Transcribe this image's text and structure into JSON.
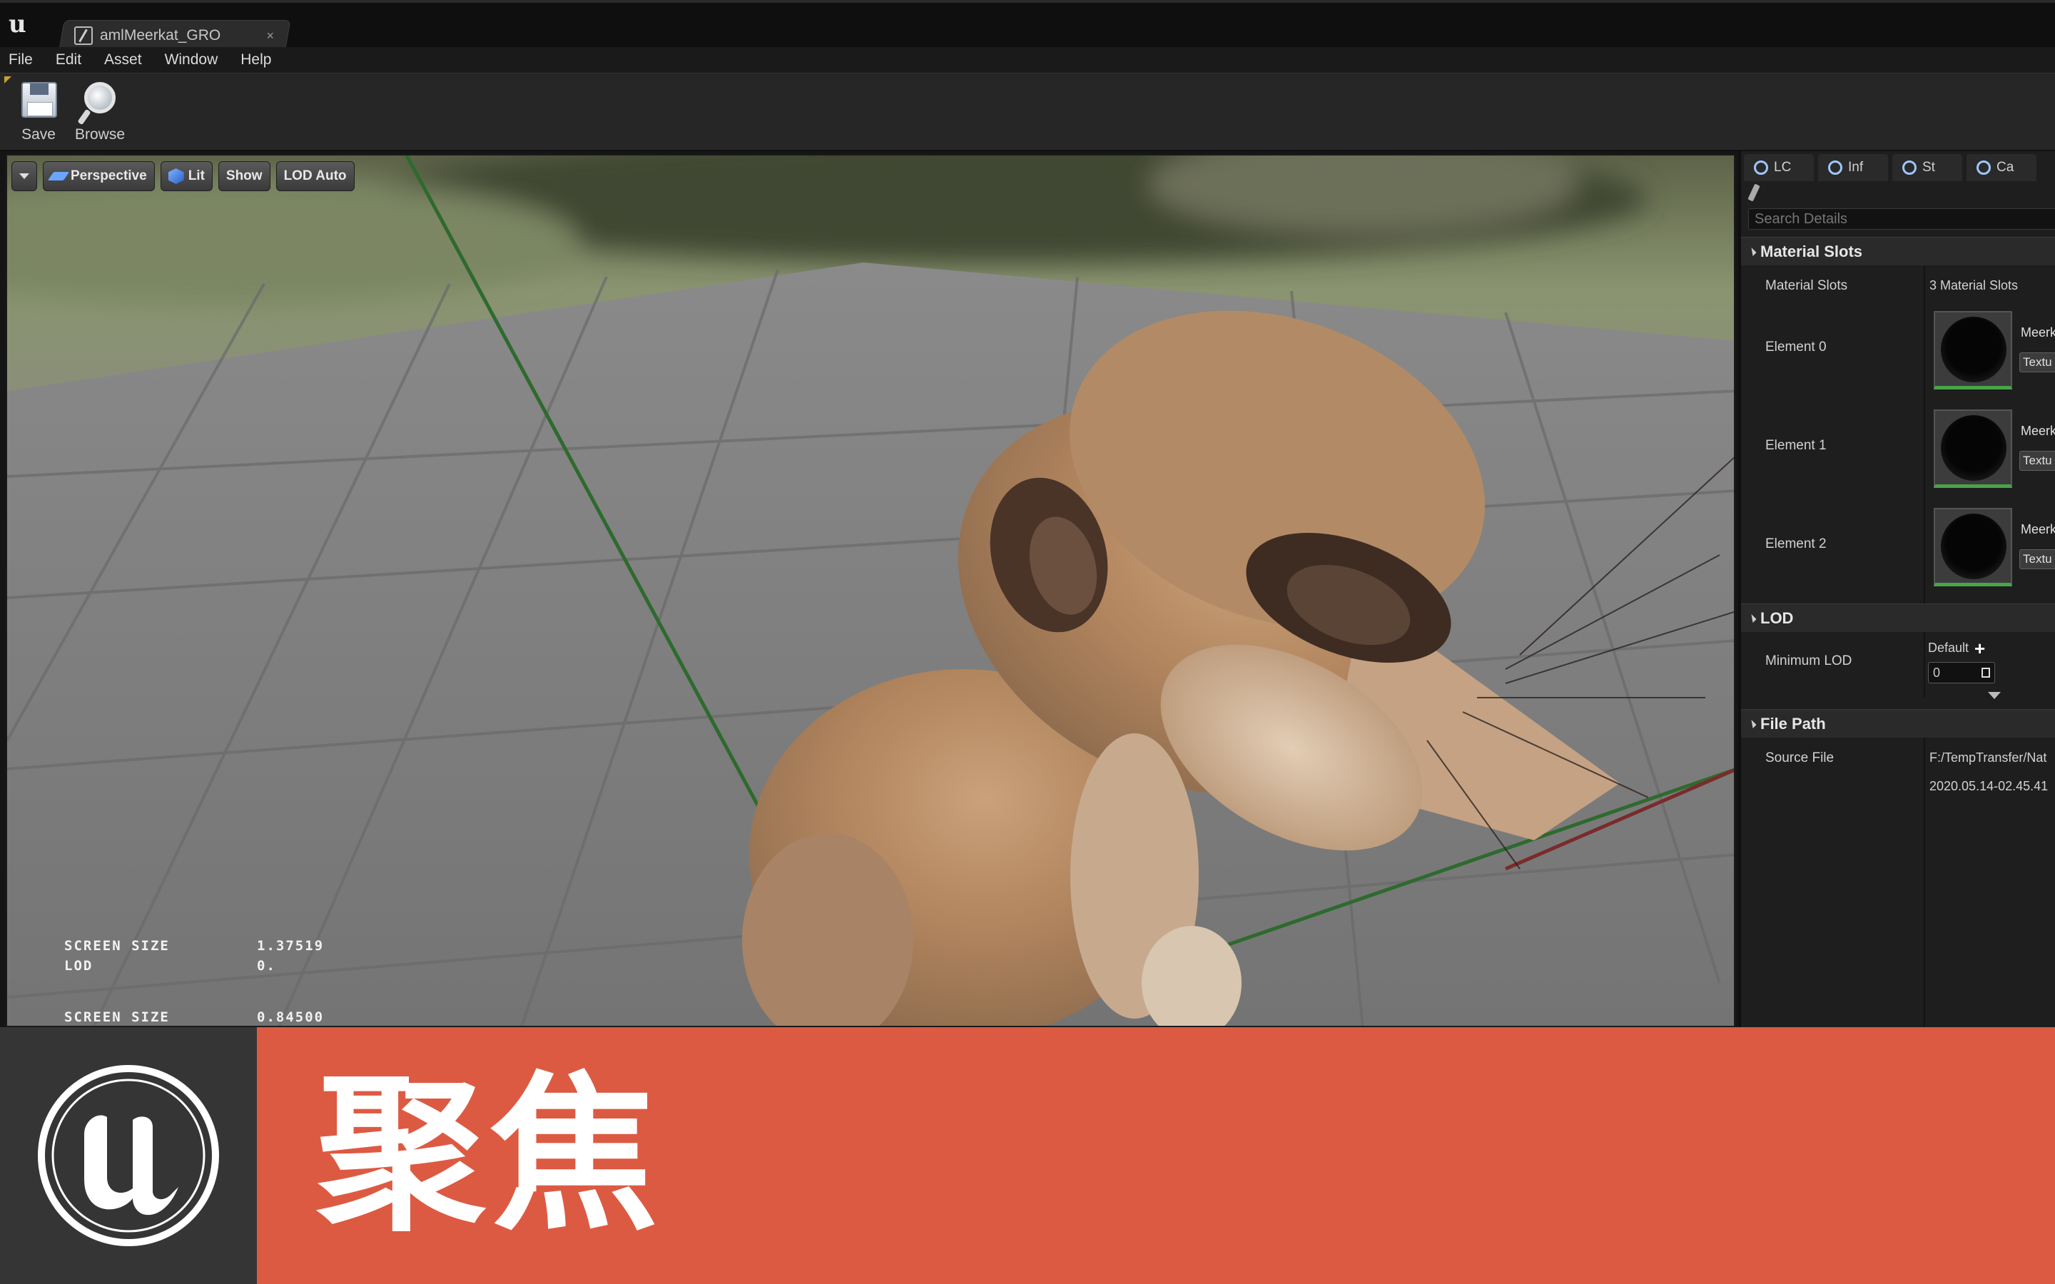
{
  "titlebar": {
    "tab_label": "amlMeerkat_GRO",
    "close_glyph": "×"
  },
  "menu": [
    "File",
    "Edit",
    "Asset",
    "Window",
    "Help"
  ],
  "toolbar": {
    "save_label": "Save",
    "browse_label": "Browse"
  },
  "viewport": {
    "buttons": {
      "perspective": "Perspective",
      "lit": "Lit",
      "show": "Show",
      "lod": "LOD Auto"
    },
    "stats": [
      {
        "key": "SCREEN SIZE",
        "value": "1.37519"
      },
      {
        "key": "LOD",
        "value": "0."
      },
      {
        "key": "SCREEN SIZE",
        "value": "0.84500"
      }
    ]
  },
  "details": {
    "tabs": [
      "LC",
      "Inf",
      "St",
      "Ca"
    ],
    "search_placeholder": "Search Details",
    "material_slots": {
      "heading": "Material Slots",
      "label": "Material Slots",
      "count": "3 Material Slots",
      "elements": [
        {
          "label": "Element 0",
          "name": "Meerk",
          "combo": "Textu"
        },
        {
          "label": "Element 1",
          "name": "Meerk",
          "combo": "Textu"
        },
        {
          "label": "Element 2",
          "name": "Meerk",
          "combo": "Textu"
        }
      ]
    },
    "lod": {
      "heading": "LOD",
      "min_label": "Minimum LOD",
      "default": "Default",
      "value": "0"
    },
    "file_path": {
      "heading": "File Path",
      "source_label": "Source File",
      "path": "F:/TempTransfer/Nat",
      "timestamp": "2020.05.14-02.45.41"
    }
  },
  "banner": {
    "text": "聚焦",
    "bg_color": "#dd5a42",
    "logo_bg": "#353535"
  }
}
